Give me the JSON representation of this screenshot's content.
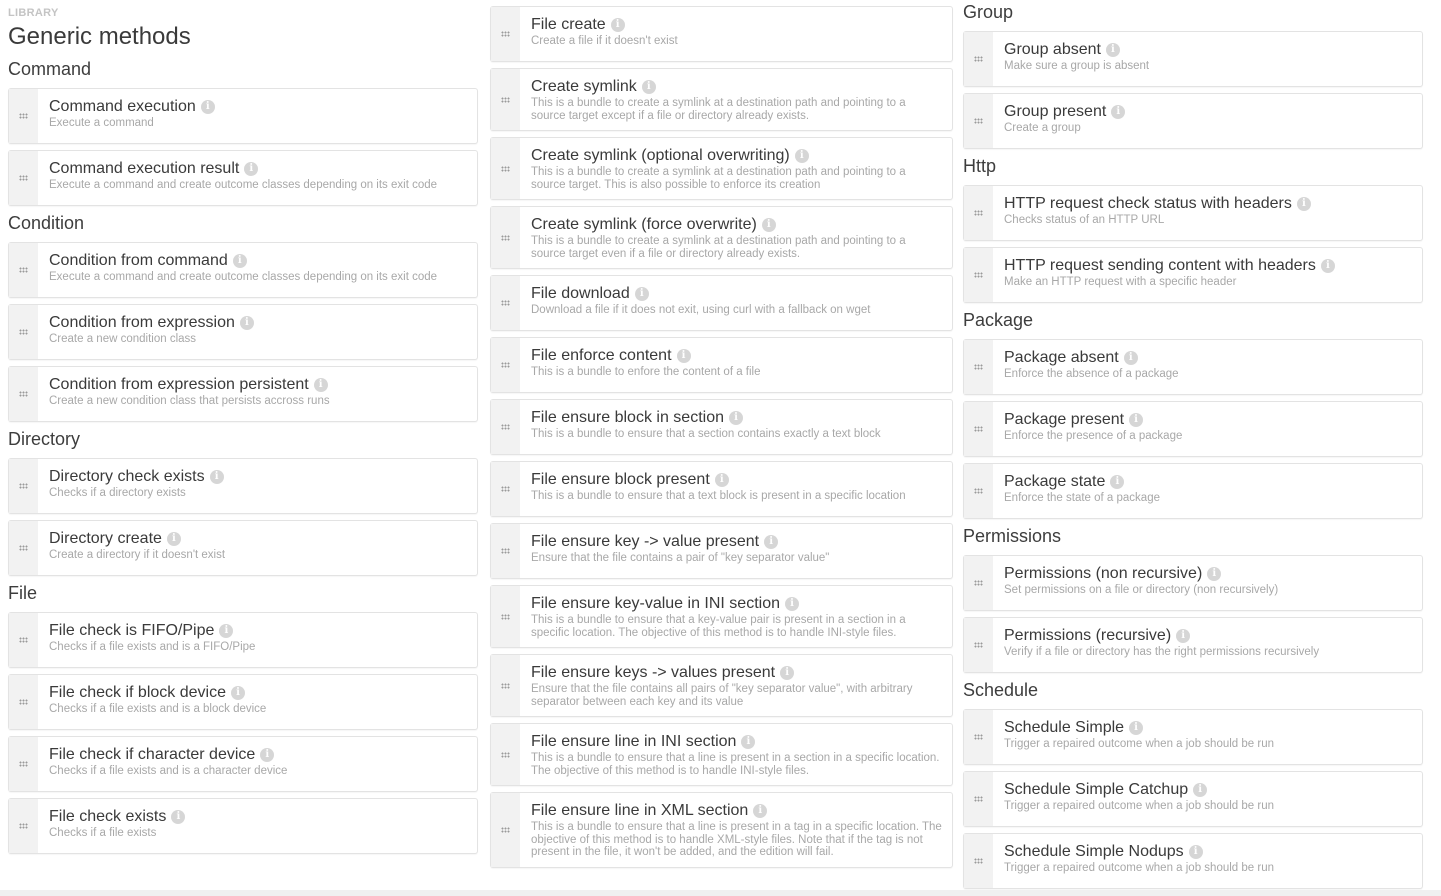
{
  "header": {
    "library_label": "LIBRARY",
    "title": "Generic methods"
  },
  "columns": [
    {
      "groups": [
        {
          "category": "Command",
          "methods": [
            {
              "title": "Command execution",
              "description": "Execute a command"
            },
            {
              "title": "Command execution result",
              "description": "Execute a command and create outcome classes depending on its exit code"
            }
          ]
        },
        {
          "category": "Condition",
          "methods": [
            {
              "title": "Condition from command",
              "description": "Execute a command and create outcome classes depending on its exit code"
            },
            {
              "title": "Condition from expression",
              "description": "Create a new condition class"
            },
            {
              "title": "Condition from expression persistent",
              "description": "Create a new condition class that persists accross runs"
            }
          ]
        },
        {
          "category": "Directory",
          "methods": [
            {
              "title": "Directory check exists",
              "description": "Checks if a directory exists"
            },
            {
              "title": "Directory create",
              "description": "Create a directory if it doesn't exist"
            }
          ]
        },
        {
          "category": "File",
          "methods": [
            {
              "title": "File check is FIFO/Pipe",
              "description": "Checks if a file exists and is a FIFO/Pipe"
            },
            {
              "title": "File check if block device",
              "description": "Checks if a file exists and is a block device"
            },
            {
              "title": "File check if character device",
              "description": "Checks if a file exists and is a character device"
            },
            {
              "title": "File check exists",
              "description": "Checks if a file exists"
            }
          ]
        }
      ]
    },
    {
      "groups": [
        {
          "category": "",
          "methods": [
            {
              "title": "File create",
              "description": "Create a file if it doesn't exist"
            },
            {
              "title": "Create symlink",
              "description": "This is a bundle to create a symlink at a destination path and pointing to a source target except if a file or directory already exists."
            },
            {
              "title": "Create symlink (optional overwriting)",
              "description": "This is a bundle to create a symlink at a destination path and pointing to a source target. This is also possible to enforce its creation"
            },
            {
              "title": "Create symlink (force overwrite)",
              "description": "This is a bundle to create a symlink at a destination path and pointing to a source target even if a file or directory already exists."
            },
            {
              "title": "File download",
              "description": "Download a file if it does not exit, using curl with a fallback on wget"
            },
            {
              "title": "File enforce content",
              "description": "This is a bundle to enfore the content of a file"
            },
            {
              "title": "File ensure block in section",
              "description": "This is a bundle to ensure that a section contains exactly a text block"
            },
            {
              "title": "File ensure block present",
              "description": "This is a bundle to ensure that a text block is present in a specific location"
            },
            {
              "title": "File ensure key -> value present",
              "description": "Ensure that the file contains a pair of \"key separator value\""
            },
            {
              "title": "File ensure key-value in INI section",
              "description": "This is a bundle to ensure that a key-value pair is present in a section in a specific location. The objective of this method is to handle INI-style files."
            },
            {
              "title": "File ensure keys -> values present",
              "description": "Ensure that the file contains all pairs of \"key separator value\", with arbitrary separator between each key and its value"
            },
            {
              "title": "File ensure line in INI section",
              "description": "This is a bundle to ensure that a line is present in a section in a specific location. The objective of this method is to handle INI-style files."
            },
            {
              "title": "File ensure line in XML section",
              "description": "This is a bundle to ensure that a line is present in a tag in a specific location. The objective of this method is to handle XML-style files. Note that if the tag is not present in the file, it won't be added, and the edition will fail."
            }
          ]
        }
      ]
    },
    {
      "groups": [
        {
          "category": "Group",
          "methods": [
            {
              "title": "Group absent",
              "description": "Make sure a group is absent"
            },
            {
              "title": "Group present",
              "description": "Create a group"
            }
          ]
        },
        {
          "category": "Http",
          "methods": [
            {
              "title": "HTTP request check status with headers",
              "description": "Checks status of an HTTP URL"
            },
            {
              "title": "HTTP request sending content with headers",
              "description": "Make an HTTP request with a specific header"
            }
          ]
        },
        {
          "category": "Package",
          "methods": [
            {
              "title": "Package absent",
              "description": "Enforce the absence of a package"
            },
            {
              "title": "Package present",
              "description": "Enforce the presence of a package"
            },
            {
              "title": "Package state",
              "description": "Enforce the state of a package"
            }
          ]
        },
        {
          "category": "Permissions",
          "methods": [
            {
              "title": "Permissions (non recursive)",
              "description": "Set permissions on a file or directory (non recursively)"
            },
            {
              "title": "Permissions (recursive)",
              "description": "Verify if a file or directory has the right permissions recursively"
            }
          ]
        },
        {
          "category": "Schedule",
          "methods": [
            {
              "title": "Schedule Simple",
              "description": "Trigger a repaired outcome when a job should be run"
            },
            {
              "title": "Schedule Simple Catchup",
              "description": "Trigger a repaired outcome when a job should be run"
            },
            {
              "title": "Schedule Simple Nodups",
              "description": "Trigger a repaired outcome when a job should be run"
            }
          ]
        }
      ]
    }
  ],
  "icons": {
    "drag_handle": "drag-handle-icon",
    "info": "info-icon",
    "info_glyph": "i"
  }
}
